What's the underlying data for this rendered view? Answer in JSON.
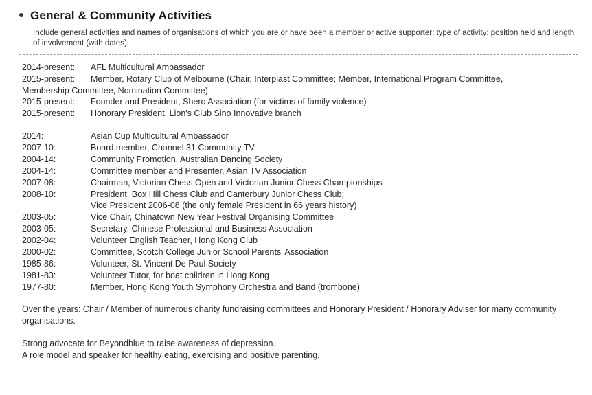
{
  "heading": "General & Community Activities",
  "intro": "Include general activities and names of organisations of which you are or have been a member or active supporter; type of activity; position held and length of involvement (with dates):",
  "current": [
    {
      "date": "2014-present:",
      "desc": "AFL Multicultural Ambassador"
    },
    {
      "date": "2015-present:",
      "desc": "Member, Rotary Club of Melbourne (Chair, Interplast Committee; Member, International Program Committee,"
    },
    {
      "date": "",
      "desc_prefix": "Membership Committee, Nomination Committee)"
    },
    {
      "date": "2015-present:",
      "desc": "Founder and President, Shero Association (for victims of family violence)"
    },
    {
      "date": "2015-present:",
      "desc": "Honorary President, Lion's Club Sino Innovative branch"
    }
  ],
  "past": [
    {
      "date": "2014:",
      "desc": "Asian Cup Multicultural Ambassador"
    },
    {
      "date": "2007-10:",
      "desc": "Board member, Channel 31 Community TV"
    },
    {
      "date": "2004-14:",
      "desc": "Community Promotion, Australian Dancing Society"
    },
    {
      "date": "2004-14:",
      "desc": "Committee member and Presenter, Asian TV Association"
    },
    {
      "date": "2007-08:",
      "desc": "Chairman, Victorian Chess Open and Victorian Junior Chess Championships"
    },
    {
      "date": "2008-10:",
      "desc": "President, Box Hill Chess Club and Canterbury Junior Chess Club;"
    },
    {
      "date": "",
      "desc": "Vice President 2006-08 (the only female President in 66 years history)"
    },
    {
      "date": "2003-05:",
      "desc": "Vice Chair, Chinatown New Year Festival Organising Committee"
    },
    {
      "date": "2003-05:",
      "desc": "Secretary, Chinese Professional and Business Association"
    },
    {
      "date": "2002-04:",
      "desc": "Volunteer English Teacher, Hong Kong Club"
    },
    {
      "date": "2000-02:",
      "desc": "Committee, Scotch College Junior School Parents' Association"
    },
    {
      "date": "1985-86:",
      "desc": "Volunteer, St. Vincent De Paul Society"
    },
    {
      "date": "1981-83:",
      "desc": "Volunteer Tutor, for boat children in Hong Kong"
    },
    {
      "date": "1977-80:",
      "desc": "Member, Hong Kong Youth Symphony Orchestra and Band (trombone)"
    }
  ],
  "notes": [
    "Over the years: Chair / Member of numerous charity fundraising committees and Honorary President / Honorary Adviser for many community organisations.",
    "Strong advocate for Beyondblue to raise awareness of depression.",
    "A role model and speaker for healthy eating, exercising and positive parenting."
  ]
}
